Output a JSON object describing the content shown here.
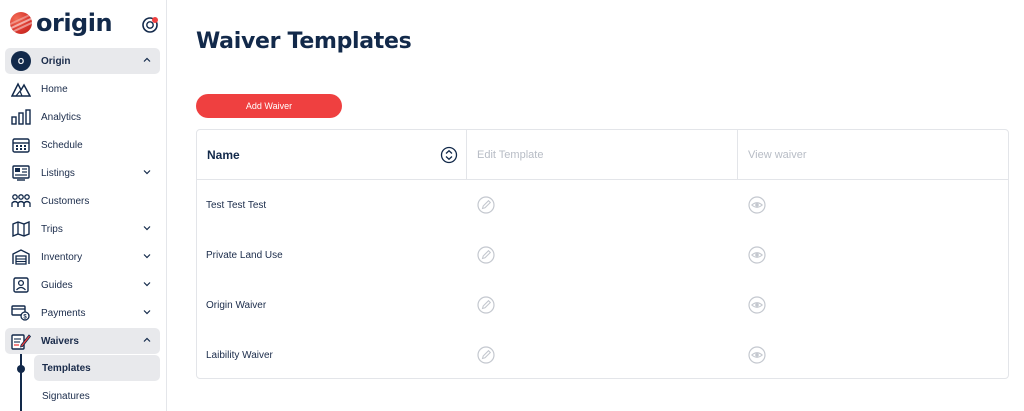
{
  "brand": {
    "name": "origin"
  },
  "sidebar": {
    "org": {
      "badge": "O",
      "label": "Origin"
    },
    "items": [
      {
        "label": "Home",
        "icon": "home-mountain-icon"
      },
      {
        "label": "Analytics",
        "icon": "bar-chart-icon"
      },
      {
        "label": "Schedule",
        "icon": "calendar-icon"
      },
      {
        "label": "Listings",
        "icon": "listings-icon"
      },
      {
        "label": "Customers",
        "icon": "customers-icon"
      },
      {
        "label": "Trips",
        "icon": "map-icon"
      },
      {
        "label": "Inventory",
        "icon": "warehouse-icon"
      },
      {
        "label": "Guides",
        "icon": "guide-badge-icon"
      },
      {
        "label": "Payments",
        "icon": "payments-icon"
      },
      {
        "label": "Waivers",
        "icon": "waiver-icon"
      }
    ],
    "sub_items": [
      {
        "label": "Templates"
      },
      {
        "label": "Signatures"
      }
    ]
  },
  "page": {
    "title": "Waiver Templates",
    "add_button": "Add Waiver"
  },
  "table": {
    "columns": [
      "Name",
      "Edit Template",
      "View waiver"
    ],
    "rows": [
      {
        "name": "Test Test Test"
      },
      {
        "name": "Private Land Use"
      },
      {
        "name": "Origin Waiver"
      },
      {
        "name": "Laibility Waiver"
      }
    ]
  },
  "colors": {
    "brand_navy": "#12294a",
    "accent_red": "#ef4040",
    "active_bg": "#e8e9ec",
    "muted_text": "#b7bcc5"
  }
}
